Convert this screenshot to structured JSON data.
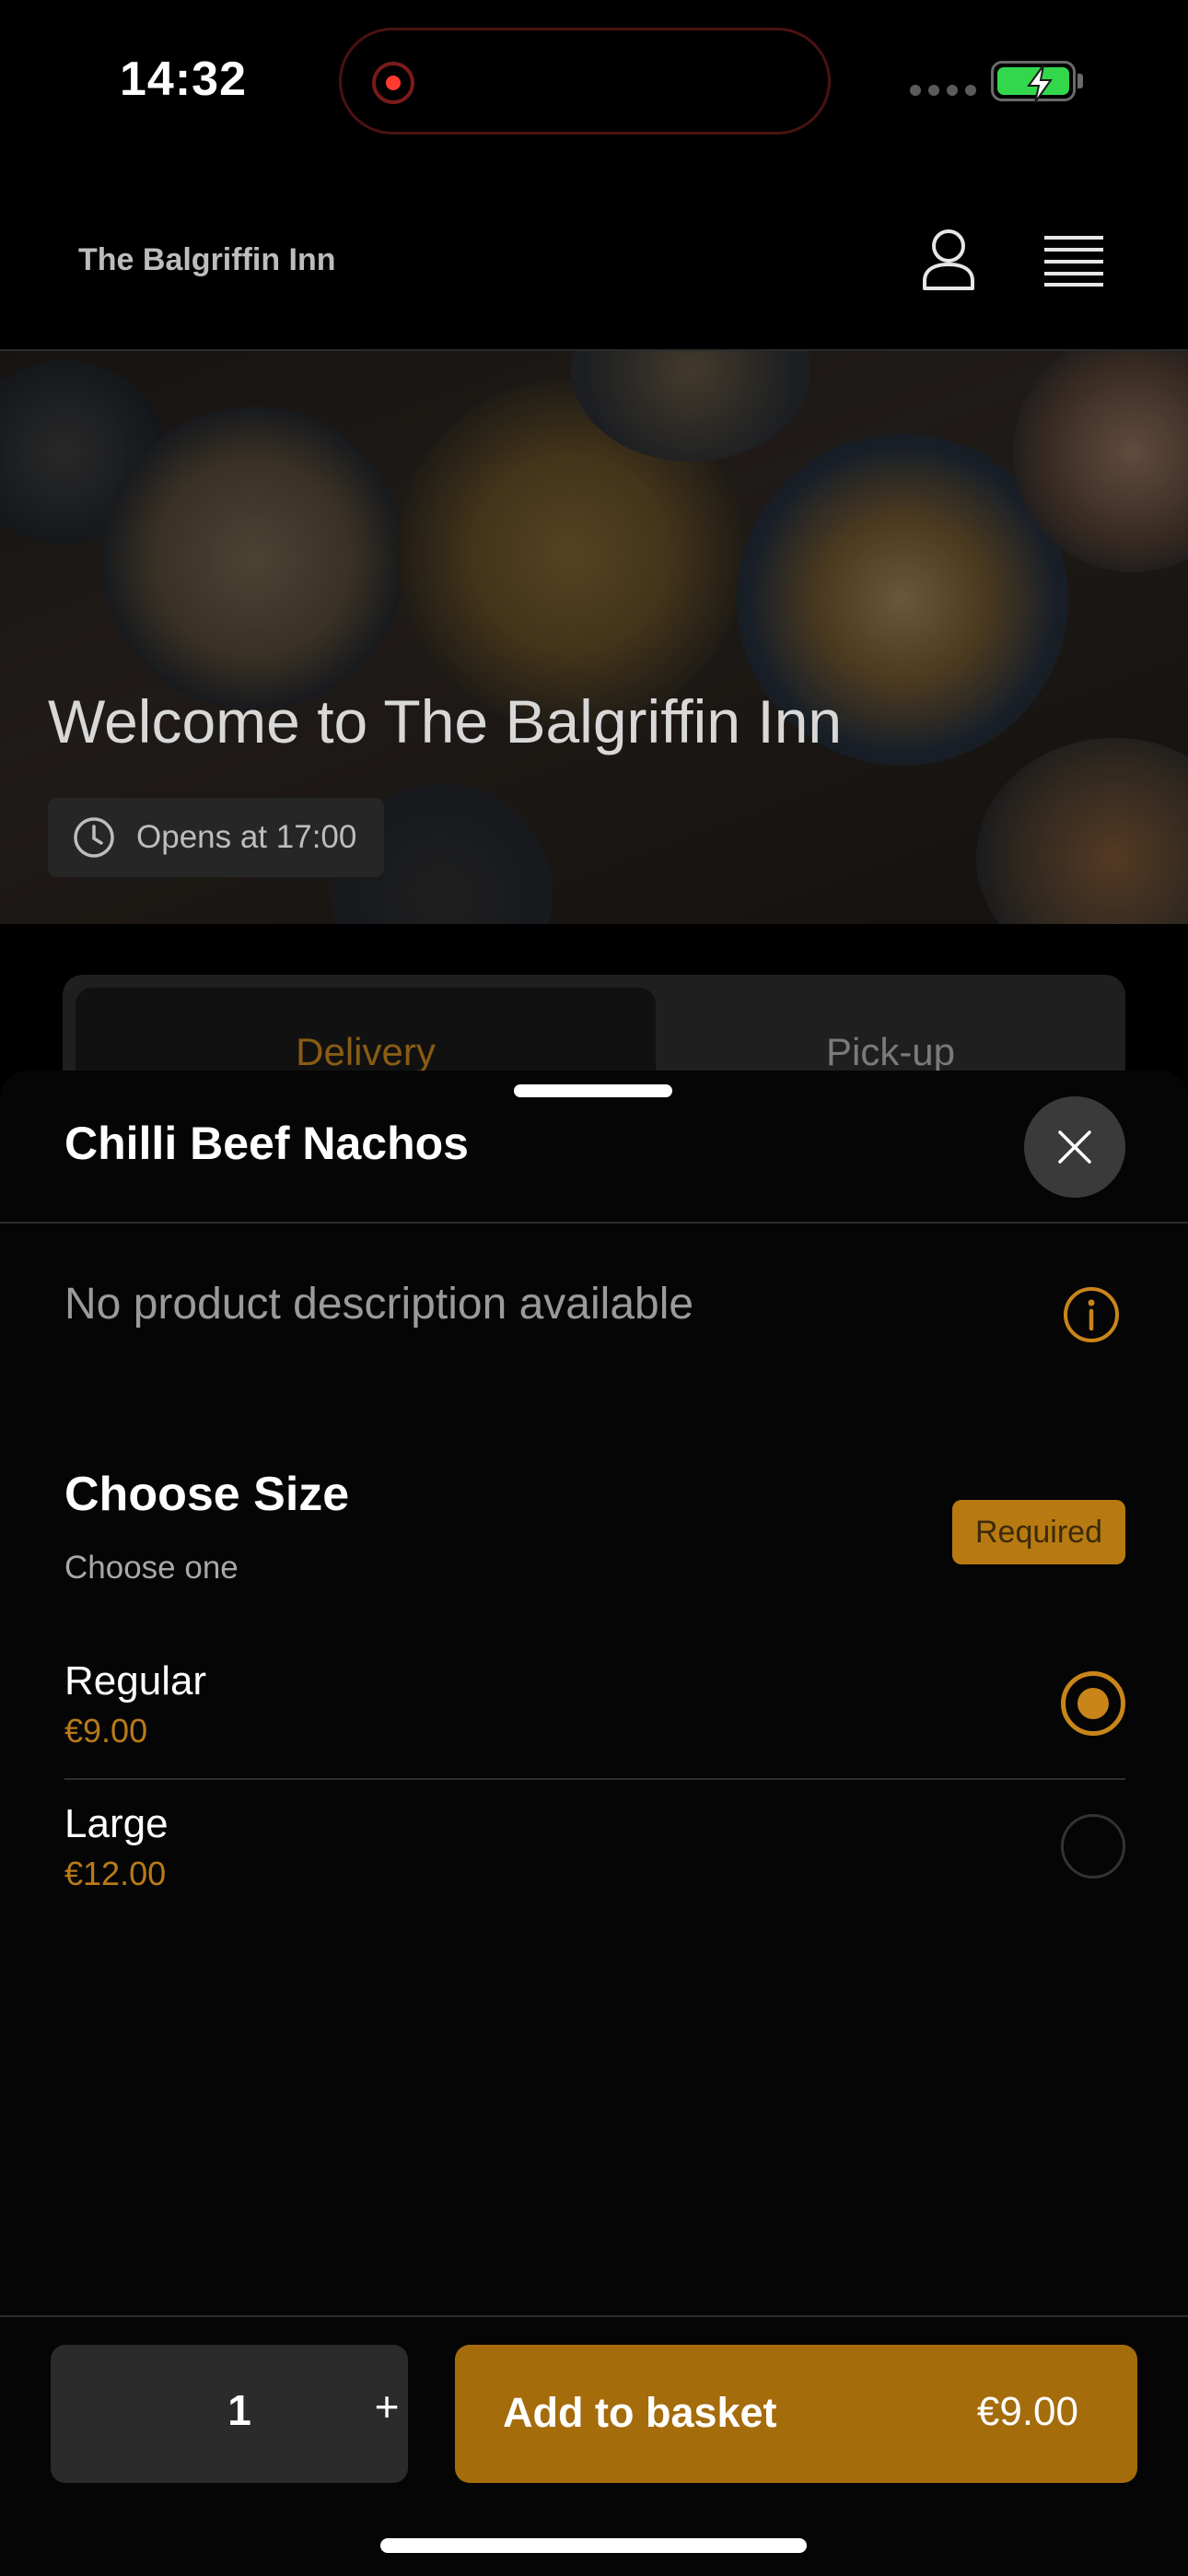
{
  "status_bar": {
    "time": "14:32",
    "battery_color": "#32d74b",
    "recording_color": "#ff3b30"
  },
  "header": {
    "brand": "The Balgriffin Inn",
    "user_icon": "user-icon",
    "menu_icon": "hamburger-menu-icon"
  },
  "hero": {
    "title": "Welcome to The Balgriffin Inn",
    "hours": "Opens at 17:00",
    "hours_icon": "clock-icon"
  },
  "order_mode": {
    "tabs": [
      {
        "label": "Delivery",
        "active": true
      },
      {
        "label": "Pick-up",
        "active": false
      }
    ]
  },
  "product": {
    "title": "Chilli Beef Nachos",
    "description": "No product description available",
    "close_icon": "close-icon",
    "info_icon": "info-icon"
  },
  "size_section": {
    "title": "Choose Size",
    "subtitle": "Choose one",
    "badge": "Required",
    "options": [
      {
        "name": "Regular",
        "price": "€9.00",
        "selected": true
      },
      {
        "name": "Large",
        "price": "€12.00",
        "selected": false
      }
    ]
  },
  "footer": {
    "quantity": "1",
    "plus": "+",
    "add_label": "Add to basket",
    "add_price": "€9.00"
  },
  "colors": {
    "accent": "#b77a12",
    "background": "#000000"
  }
}
